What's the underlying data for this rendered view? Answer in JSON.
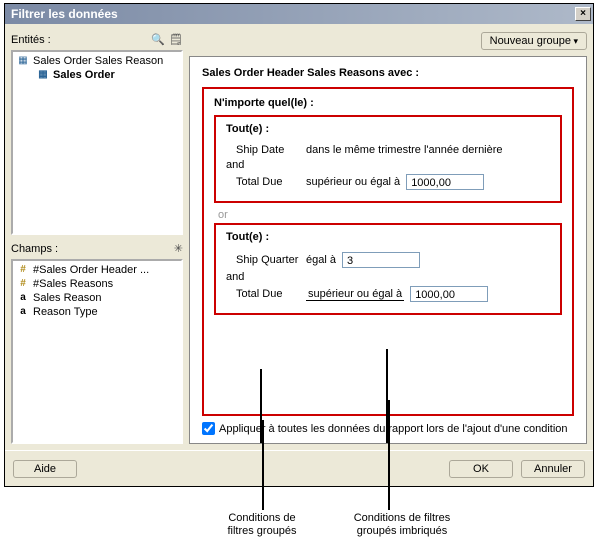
{
  "window": {
    "title": "Filtrer les données",
    "close_glyph": "×"
  },
  "left": {
    "entities_label": "Entités :",
    "entities": [
      {
        "label": "Sales Order Sales Reason",
        "bold": false
      },
      {
        "label": "Sales Order",
        "bold": true
      }
    ],
    "champs_label": "Champs :",
    "champs": [
      {
        "icon": "hash",
        "label": "#Sales Order Header ..."
      },
      {
        "icon": "hash",
        "label": "#Sales Reasons"
      },
      {
        "icon": "a",
        "label": "Sales Reason"
      },
      {
        "icon": "a",
        "label": "Reason Type"
      }
    ]
  },
  "toolbar": {
    "new_group": "Nouveau groupe"
  },
  "main": {
    "heading": "Sales Order Header Sales Reasons avec :",
    "outer_group_title": "N'importe quel(le) :",
    "group1": {
      "title": "Tout(e) :",
      "c1_field": "Ship Date",
      "c1_op": "dans le même trimestre l'année dernière",
      "and": "and",
      "c2_field": "Total Due",
      "c2_op": "supérieur ou égal à",
      "c2_val": "1000,00"
    },
    "or": "or",
    "group2": {
      "title": "Tout(e) :",
      "c1_field": "Ship Quarter",
      "c1_op": "égal à",
      "c1_val": "3",
      "and": "and",
      "c2_field": "Total Due",
      "c2_op": "supérieur ou égal à",
      "c2_val": "1000,00"
    },
    "apply_all": "Appliquer à toutes les données du rapport lors de l'ajout d'une condition"
  },
  "footer": {
    "help": "Aide",
    "ok": "OK",
    "cancel": "Annuler"
  },
  "callouts": {
    "c1a": "Conditions de",
    "c1b": "filtres groupés",
    "c2a": "Conditions de filtres",
    "c2b": "groupés imbriqués"
  }
}
